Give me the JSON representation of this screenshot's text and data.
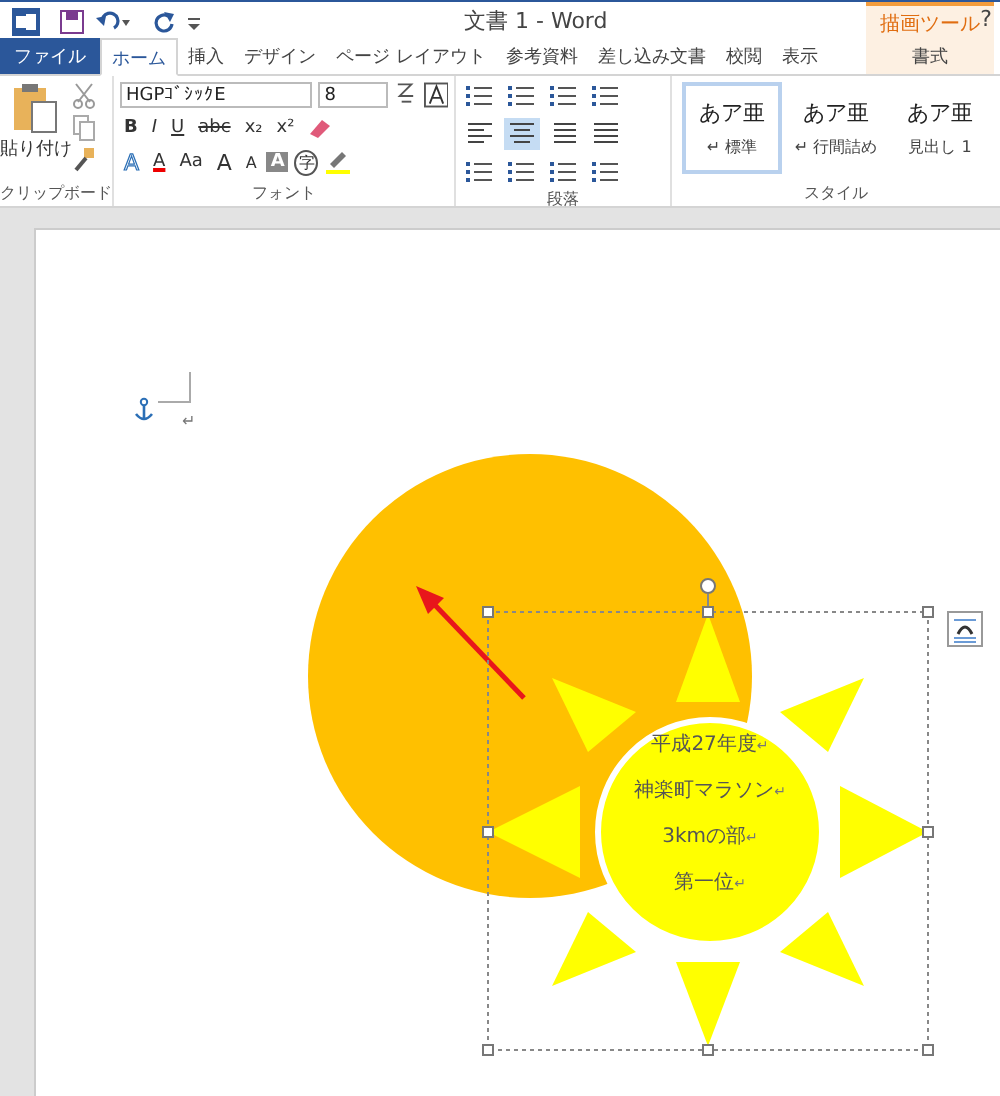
{
  "window": {
    "title": "文書 1 - Word",
    "help": "?"
  },
  "contextual": {
    "label": "描画ツール"
  },
  "tabs": [
    {
      "label": "ファイル",
      "kind": "file",
      "selected": false
    },
    {
      "label": "ホーム",
      "kind": "normal",
      "selected": true
    },
    {
      "label": "挿入",
      "kind": "normal",
      "selected": false
    },
    {
      "label": "デザイン",
      "kind": "normal",
      "selected": false
    },
    {
      "label": "ページ レイアウト",
      "kind": "normal",
      "selected": false
    },
    {
      "label": "参考資料",
      "kind": "normal",
      "selected": false
    },
    {
      "label": "差し込み文書",
      "kind": "normal",
      "selected": false
    },
    {
      "label": "校閲",
      "kind": "normal",
      "selected": false
    },
    {
      "label": "表示",
      "kind": "normal",
      "selected": false
    },
    {
      "label": "書式",
      "kind": "contextual",
      "selected": false
    }
  ],
  "clipboard": {
    "paste": "貼り付け",
    "group": "クリップボード"
  },
  "font": {
    "name": "HGPｺﾞｼｯｸE",
    "size": "8",
    "group": "フォント",
    "row1": [
      {
        "label": "B",
        "kind": "bold"
      },
      {
        "label": "I",
        "kind": "italic"
      },
      {
        "label": "U",
        "kind": "underline"
      },
      {
        "label": "abc",
        "kind": "strike"
      },
      {
        "label": "x₂",
        "kind": "plain"
      },
      {
        "label": "x²",
        "kind": "plain"
      }
    ],
    "row2": [
      {
        "label": "A",
        "kind": "outline"
      },
      {
        "label": "A",
        "kind": "color"
      },
      {
        "label": "Aa",
        "kind": "plain"
      },
      {
        "label": "A",
        "kind": "grow"
      },
      {
        "label": "A",
        "kind": "shrink"
      },
      {
        "label": "A",
        "kind": "shaded"
      },
      {
        "label": "字",
        "kind": "circled"
      }
    ]
  },
  "paragraph": {
    "group": "段落",
    "align_buttons": [
      {
        "selected": false
      },
      {
        "selected": true
      },
      {
        "selected": false
      },
      {
        "selected": false
      }
    ]
  },
  "styles": {
    "group": "スタイル",
    "items": [
      {
        "sample": "あア亜",
        "label": "↵ 標準",
        "selected": true
      },
      {
        "sample": "あア亜",
        "label": "↵ 行間詰め",
        "selected": false
      },
      {
        "sample": "あア亜",
        "label": "見出し 1",
        "selected": false
      }
    ]
  },
  "document": {
    "paragraph_mark": "↵",
    "sun_text": [
      {
        "text": "平成27年度",
        "mark": "↵"
      },
      {
        "text": "神楽町マラソン",
        "mark": "↵"
      },
      {
        "text": "3kmの部",
        "mark": "↵"
      },
      {
        "text": "第一位",
        "mark": "↵"
      }
    ]
  }
}
